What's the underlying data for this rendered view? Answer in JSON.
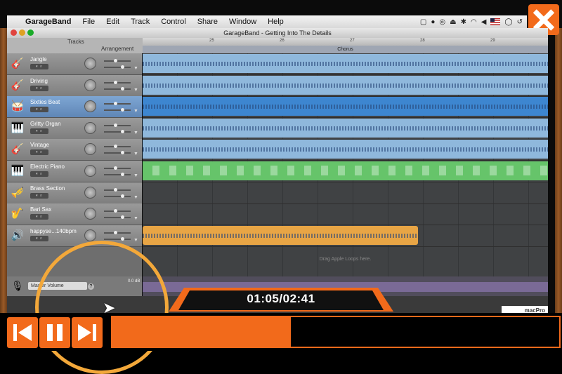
{
  "menubar": {
    "app": "GarageBand",
    "items": [
      "File",
      "Edit",
      "Track",
      "Control",
      "Share",
      "Window",
      "Help"
    ]
  },
  "window": {
    "title": "GarageBand - Getting Into The Details"
  },
  "header": {
    "tracks_label": "Tracks",
    "arrangement_label": "Arrangement",
    "chorus_label": "Chorus",
    "ruler": [
      "25",
      "26",
      "27",
      "28",
      "29"
    ]
  },
  "tracks": [
    {
      "name": "Jangle",
      "icon": "guitar-icon",
      "color": "#8fb8dc",
      "type": "audio"
    },
    {
      "name": "Driving",
      "icon": "guitar-icon",
      "color": "#8fb8dc",
      "type": "audio"
    },
    {
      "name": "Sixties Beat",
      "icon": "drums-icon",
      "color": "#3d86d0",
      "type": "audio",
      "selected": true
    },
    {
      "name": "Gritty Organ",
      "icon": "organ-icon",
      "color": "#8fb8dc",
      "type": "audio"
    },
    {
      "name": "Vintage",
      "icon": "guitar-icon",
      "color": "#8fb8dc",
      "type": "audio"
    },
    {
      "name": "Electric Piano",
      "icon": "keyboard-icon",
      "color": "#66c46a",
      "type": "midi"
    },
    {
      "name": "Brass Section",
      "icon": "trumpet-icon",
      "color": null,
      "type": "empty"
    },
    {
      "name": "Bari Sax",
      "icon": "sax-icon",
      "color": null,
      "type": "empty"
    },
    {
      "name": "happyse...140bpm",
      "icon": "loop-icon",
      "color": "#e8a545",
      "type": "loop",
      "region_fraction": 0.68
    }
  ],
  "timeline": {
    "drop_message": "Drag Apple Loops here."
  },
  "master": {
    "label": "Master Volume",
    "db": "0.0 dB"
  },
  "player": {
    "current_time": "01:05",
    "total_time": "02:41",
    "time_display": "01:05/02:41",
    "progress": 0.4,
    "accent": "#f26a1b"
  },
  "brand": "macPro"
}
